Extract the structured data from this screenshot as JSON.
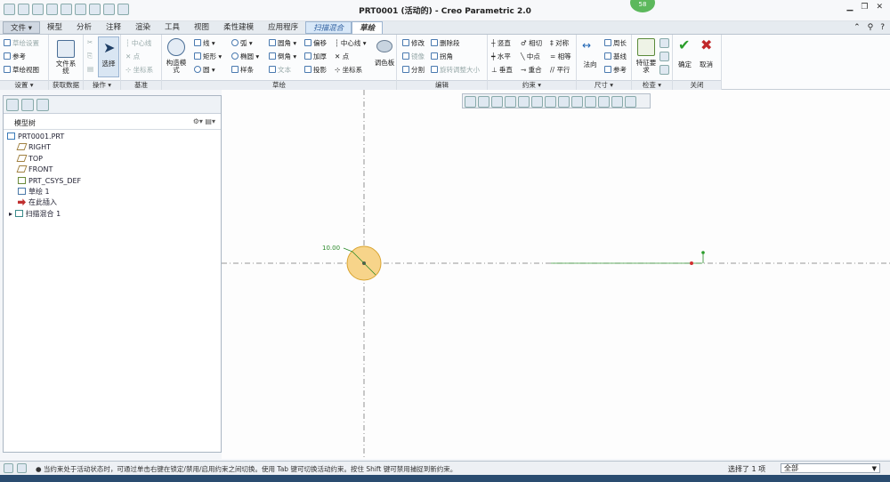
{
  "window": {
    "title": "PRT0001 (活动的) - Creo Parametric 2.0",
    "badge": "58"
  },
  "tabs": [
    {
      "label": "文件 ▾",
      "kind": "file"
    },
    {
      "label": "模型"
    },
    {
      "label": "分析"
    },
    {
      "label": "注释"
    },
    {
      "label": "渲染"
    },
    {
      "label": "工具"
    },
    {
      "label": "视图"
    },
    {
      "label": "柔性建模"
    },
    {
      "label": "应用程序"
    },
    {
      "label": "扫描混合",
      "kind": "ctx"
    },
    {
      "label": "草绘",
      "kind": "active"
    }
  ],
  "ribbon": {
    "settings": {
      "group": "设置 ▾",
      "items": [
        "草绘设置",
        "参考",
        "草绘视图"
      ]
    },
    "getdata": {
      "group": "获取数据",
      "file_system": "文件系统"
    },
    "ops": {
      "group": "操作 ▾",
      "select": "选择"
    },
    "datum": {
      "group": "基准",
      "items": [
        "中心线",
        "点",
        "坐标系"
      ]
    },
    "sketch": {
      "group": "草绘",
      "construction": "构造模式",
      "col1": [
        "线 ▾",
        "矩形 ▾",
        "圆 ▾"
      ],
      "col2": [
        "弧 ▾",
        "椭圆 ▾",
        "样条"
      ],
      "col3": [
        "圆角 ▾",
        "倒角 ▾",
        "文本"
      ],
      "col4": [
        "偏移",
        "加厚",
        "投影"
      ],
      "col5": [
        "中心线 ▾",
        "点",
        "坐标系"
      ],
      "palette": "调色板"
    },
    "edit": {
      "group": "编辑",
      "items": [
        "修改",
        "删除段",
        "镜像",
        "拐角",
        "分割",
        "旋转调整大小"
      ]
    },
    "constrain": {
      "group": "约束 ▾",
      "items": [
        "竖直",
        "相切",
        "对称",
        "水平",
        "中点",
        "相等",
        "垂直",
        "重合",
        "平行"
      ]
    },
    "dimension": {
      "group": "尺寸 ▾",
      "normal": "法向",
      "items": [
        "周长",
        "基线",
        "参考"
      ]
    },
    "inspect": {
      "group": "检查 ▾",
      "feature": "特征要求"
    },
    "close": {
      "group": "关闭",
      "ok": "确定",
      "cancel": "取消"
    }
  },
  "model_tree": {
    "header": "模型树",
    "items": [
      {
        "label": "PRT0001.PRT",
        "icon": "part-icon",
        "level": 0
      },
      {
        "label": "RIGHT",
        "icon": "datum-plane-icon",
        "level": 1
      },
      {
        "label": "TOP",
        "icon": "datum-plane-icon",
        "level": 1
      },
      {
        "label": "FRONT",
        "icon": "datum-plane-icon",
        "level": 1
      },
      {
        "label": "PRT_CSYS_DEF",
        "icon": "csys-icon",
        "level": 1
      },
      {
        "label": "草绘 1",
        "icon": "sketch-icon",
        "level": 1
      },
      {
        "label": "在此插入",
        "icon": "insert-arrow-icon",
        "level": 1
      },
      {
        "label": "扫描混合 1",
        "icon": "sweep-blend-icon",
        "level": 1
      }
    ]
  },
  "canvas": {
    "dimension": "10.00"
  },
  "status": {
    "message": "● 当约束处于活动状态时，可通过单击右键在锁定/禁用/启用约束之间切换。使用 Tab 键可切换活动约束。按住 Shift 键可禁用捕捉到新约束。",
    "selection": "选择了 1 项",
    "filter": "全部"
  },
  "colors": {
    "accent": "#1e64b4",
    "ok": "#2a9d2a",
    "cancel": "#c0282a",
    "circle_fill": "#f7d48a",
    "circle_stroke": "#d9a430"
  }
}
